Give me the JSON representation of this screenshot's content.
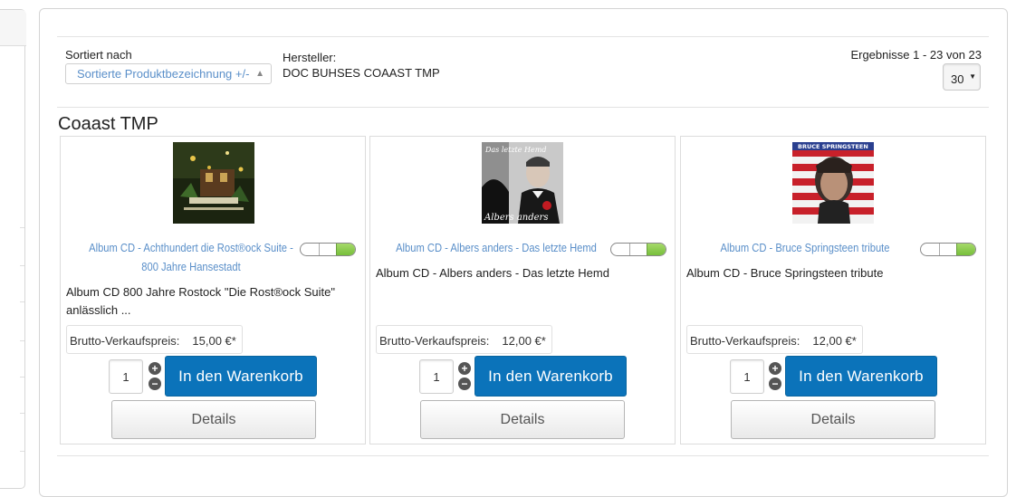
{
  "toolbar": {
    "sort_label": "Sortiert nach",
    "sort_value": "Sortierte Produktbezeichnung +/-",
    "maker_label": "Hersteller:",
    "maker_value": "DOC BUHSES COAAST TMP",
    "results": "Ergebnisse 1 - 23 von 23",
    "per_page": "30"
  },
  "section_title": "Coaast TMP",
  "products": [
    {
      "title_line1": "Album CD - Achthundert die Rost®ock Suite -",
      "title_line2": "800 Jahre Hansestadt",
      "desc_line1": "Album CD 800 Jahre Rostock \"Die Rost®ock Suite\"",
      "desc_line2": "anlässlich ...",
      "price_label": "Brutto-Verkaufspreis:",
      "price": "15,00 €*",
      "qty": "1",
      "cart": "In den Warenkorb",
      "details": "Details"
    },
    {
      "title_line1": "Album CD - Albers anders - Das letzte Hemd",
      "desc_line1": "Album CD - Albers anders - Das letzte Hemd",
      "price_label": "Brutto-Verkaufspreis:",
      "price": "12,00 €*",
      "qty": "1",
      "cart": "In den Warenkorb",
      "details": "Details",
      "cover_text1": "Das letzte Hemd",
      "cover_text2": "Albers anders"
    },
    {
      "title_line1": "Album CD - Bruce Springsteen tribute",
      "desc_line1": "Album CD - Bruce Springsteen tribute",
      "price_label": "Brutto-Verkaufspreis:",
      "price": "12,00 €*",
      "qty": "1",
      "cart": "In den Warenkorb",
      "details": "Details",
      "cover_text1": "BRUCE SPRINGSTEEN"
    }
  ],
  "colors": {
    "link": "#5a8fc9",
    "cart_button": "#0b73ba",
    "toggle_on": "#7cc23f"
  },
  "icons": {
    "sort": "sort-arrows-icon",
    "plus": "plus-icon",
    "minus": "minus-icon",
    "caret": "caret-down-icon"
  }
}
